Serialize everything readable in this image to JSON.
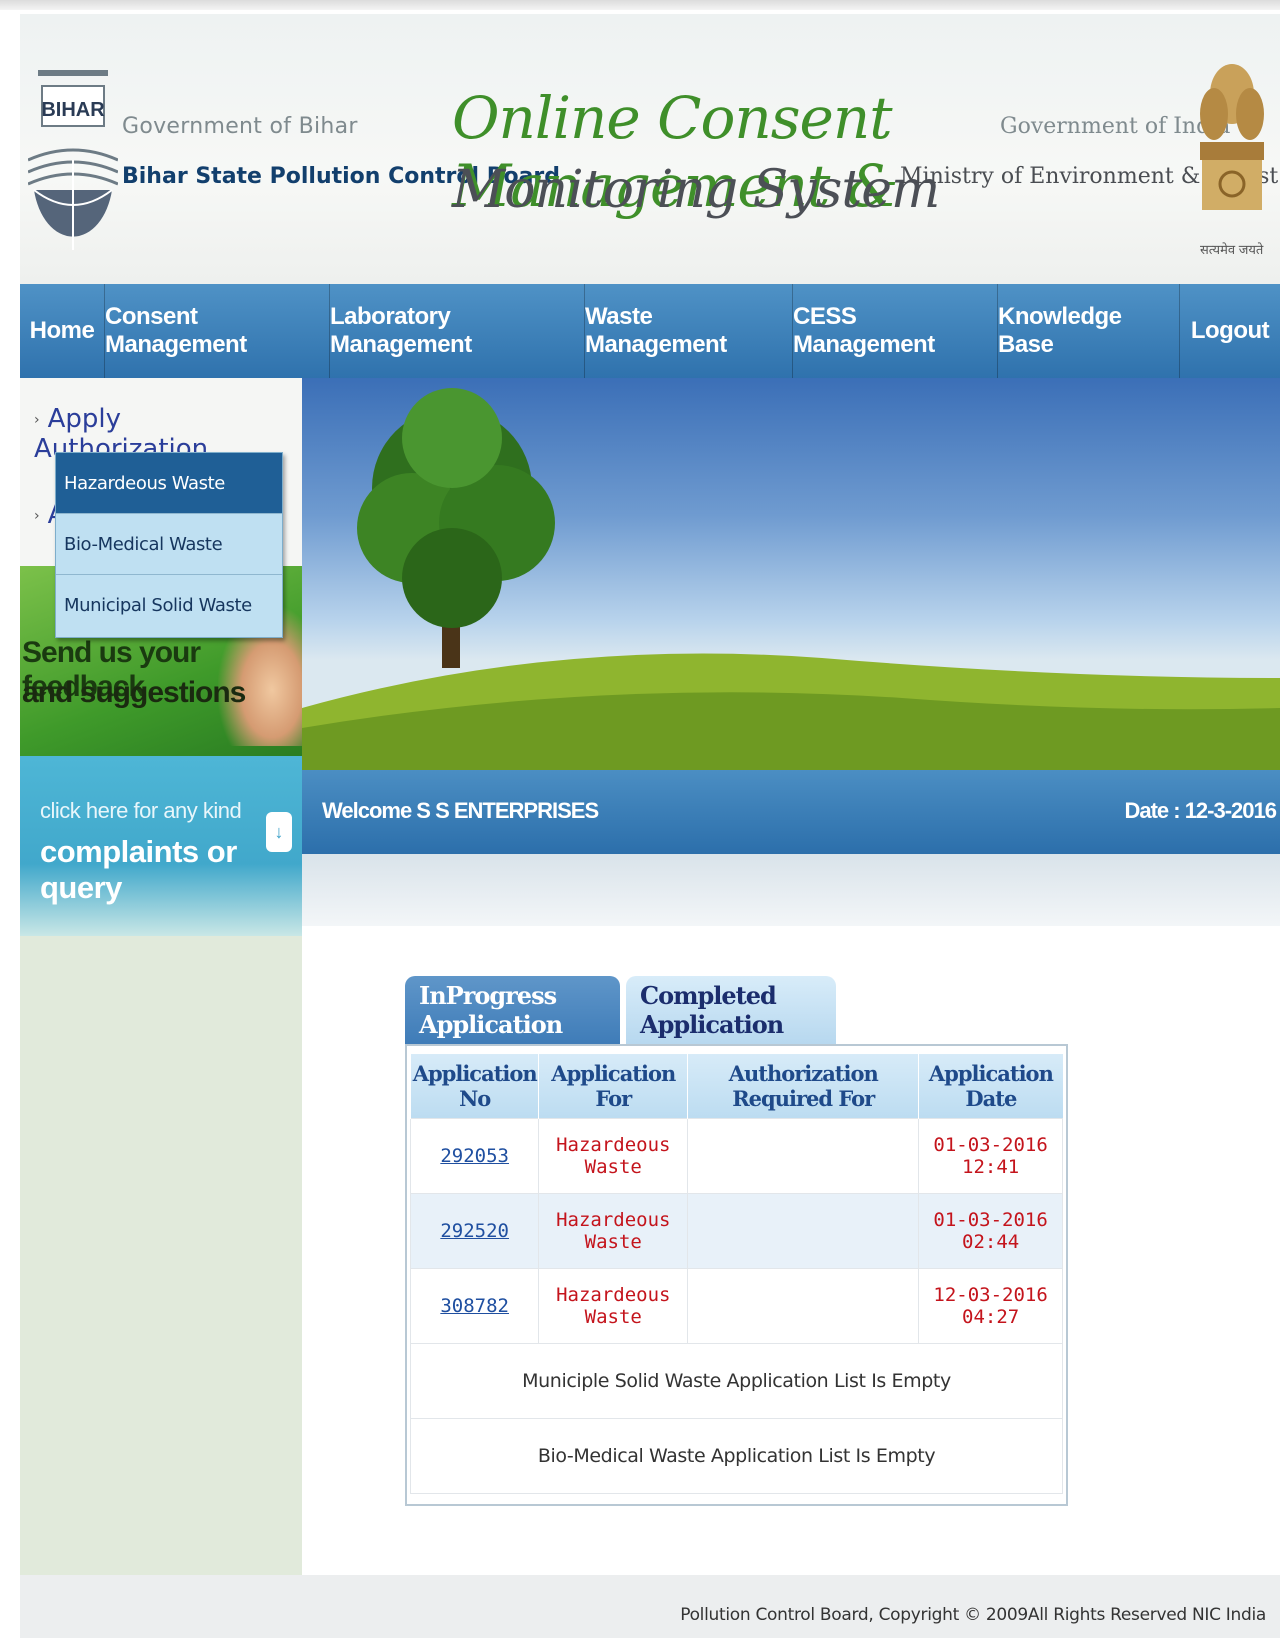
{
  "header": {
    "logo_text": "BIHAR",
    "gov_bihar": "Government of Bihar",
    "board_name": "Bihar State Pollution Control Board",
    "title_line1": "Online Consent Management &",
    "title_line2": "Monitoring System",
    "gov_india": "Government of India",
    "ministry": "Ministry of Environment & Forest",
    "emblem_motto": "सत्यमेव जयते"
  },
  "nav": {
    "items": [
      {
        "label": "Home"
      },
      {
        "label": "Consent Management"
      },
      {
        "label": "Laboratory Management"
      },
      {
        "label": "Waste Management"
      },
      {
        "label": "CESS Management"
      },
      {
        "label": "Knowledge Base"
      },
      {
        "label": "Logout"
      }
    ]
  },
  "sidebar": {
    "links": [
      {
        "label": "Apply Authorization"
      },
      {
        "label": "A"
      }
    ],
    "feedback": {
      "line1": "Send us your feedback",
      "line2": "and suggestions"
    },
    "complaint": {
      "line1": "click here for any kind",
      "line2": "complaints or query",
      "button": "↓"
    }
  },
  "dropdown": {
    "items": [
      {
        "label": "Hazardeous Waste",
        "active": true
      },
      {
        "label": "Bio-Medical Waste",
        "active": false
      },
      {
        "label": "Municipal Solid Waste",
        "active": false
      }
    ]
  },
  "welcome": {
    "text": "Welcome S S ENTERPRISES",
    "date": "Date : 12-3-2016"
  },
  "tabs": [
    {
      "label": "InProgress Application",
      "active": true
    },
    {
      "label": "Completed Application",
      "active": false
    }
  ],
  "table": {
    "headers": [
      "Application No",
      "Application For",
      "Authorization Required For",
      "Application Date"
    ],
    "rows": [
      {
        "app_no": "292053",
        "app_for": "Hazardeous Waste",
        "auth_for": "",
        "date": "01-03-2016 12:41"
      },
      {
        "app_no": "292520",
        "app_for": "Hazardeous Waste",
        "auth_for": "",
        "date": "01-03-2016 02:44"
      },
      {
        "app_no": "308782",
        "app_for": "Hazardeous Waste",
        "auth_for": "",
        "date": "12-03-2016 04:27"
      }
    ],
    "empty_messages": [
      "Municiple Solid Waste Application List Is Empty",
      "Bio-Medical Waste Application List Is Empty"
    ]
  },
  "footer": {
    "copyright": "Pollution Control Board, Copyright © 2009All Rights Reserved NIC India"
  }
}
